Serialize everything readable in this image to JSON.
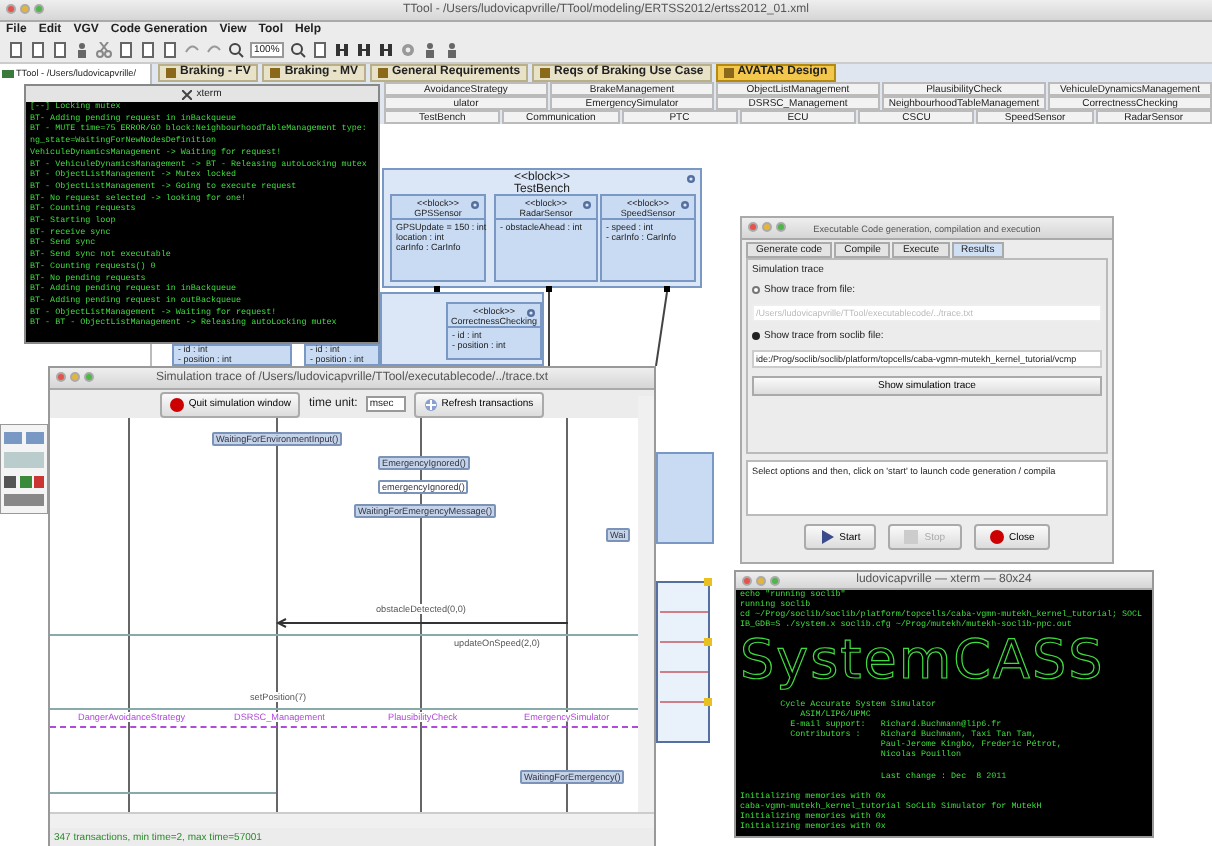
{
  "main_window": {
    "title": "TTool - /Users/ludovicapvrille/TTool/modeling/ERTSS2012/ertss2012_01.xml",
    "menu": [
      "File",
      "Edit",
      "VGV",
      "Code Generation",
      "View",
      "Tool",
      "Help"
    ],
    "zoom": "100%",
    "tree_root": "TTool - /Users/ludovicapvrille/",
    "tabs": [
      {
        "label": "Braking - FV",
        "selected": false
      },
      {
        "label": "Braking - MV",
        "selected": false
      },
      {
        "label": "General Requirements",
        "selected": false
      },
      {
        "label": "Reqs of Braking Use Case",
        "selected": false
      },
      {
        "label": "AVATAR Design",
        "selected": true
      }
    ],
    "diagram_tab_rows": [
      [
        "AvoidanceStrategy",
        "BrakeManagement",
        "ObjectListManagement",
        "PlausibilityCheck",
        "VehiculeDynamicsManagement"
      ],
      [
        "ulator",
        "EmergencySimulator",
        "DSRSC_Management",
        "NeighbourhoodTableManagement",
        "CorrectnessChecking"
      ],
      [
        "TestBench",
        "Communication",
        "PTC",
        "ECU",
        "CSCU",
        "SpeedSensor",
        "RadarSensor"
      ]
    ],
    "blocks": [
      {
        "stereotype": "<<block>>",
        "name": "TestBench",
        "children": [
          {
            "stereotype": "<<block>>",
            "name": "GPSSensor",
            "attributes": [
              "GPSUpdate = 150 : int",
              "location : int",
              "carInfo : CarInfo"
            ]
          },
          {
            "stereotype": "<<block>>",
            "name": "RadarSensor",
            "attributes": [
              "- obstacleAhead : int"
            ]
          },
          {
            "stereotype": "<<block>>",
            "name": "SpeedSensor",
            "attributes": [
              "- speed : int",
              "- carInfo : CarInfo"
            ]
          }
        ]
      },
      {
        "children": [
          {
            "attributes": [
              "- id : int",
              "- position : int"
            ]
          },
          {
            "attributes": [
              "- id : int",
              "- position : int"
            ]
          },
          {
            "stereotype": "<<block>>",
            "name": "CorrectnessChecking",
            "attributes": [
              "- id : int",
              "- position : int"
            ]
          }
        ]
      }
    ]
  },
  "xterm": {
    "title": "xterm",
    "lines": [
      "[--] Locking mutex",
      "BT- Adding pending request in inBackqueue",
      "BT - MUTE time=75 ERROR/GO block:NeighbourhoodTableManagement type:",
      "ng_state=WaitingForNewNodesDefinition",
      "VehiculeDynamicsManagement -> Waiting for request!",
      "BT - VehiculeDynamicsManagement -> BT - Releasing autoLocking mutex",
      "BT - ObjectListManagement -> Mutex locked",
      "BT - ObjectListManagement -> Going to execute request",
      "BT- No request selected -> looking for one!",
      "BT- Counting requests",
      "BT- Starting loop",
      "BT- receive sync",
      "BT- Send sync",
      "BT- Send sync not executable",
      "BT- Counting requests() 0",
      "BT- No pending requests",
      "BT- Adding pending request in inBackqueue",
      "BT- Adding pending request in outBackqueue",
      "BT - ObjectListManagement -> Waiting for request!",
      "BT - BT - ObjectListManagement -> Releasing autoLocking mutex"
    ]
  },
  "simulation_trace": {
    "title": "Simulation trace of /Users/ludovicapvrille/TTool/executablecode/../trace.txt",
    "quit_button": "Quit simulation window",
    "time_unit_label": "time unit:",
    "time_unit": "msec",
    "refresh_button": "Refresh transactions",
    "events": [
      {
        "label": "WaitingForEnvironmentInput()",
        "kind": "state"
      },
      {
        "label": "EmergencyIgnored()",
        "kind": "state"
      },
      {
        "label": "emergencyIgnored()",
        "kind": "action"
      },
      {
        "label": "WaitingForEmergencyMessage()",
        "kind": "state"
      },
      {
        "label": "Wai",
        "kind": "state"
      },
      {
        "label": "obstacleDetected(0,0)",
        "kind": "message"
      },
      {
        "label": "updateOnSpeed(2,0)",
        "kind": "message"
      },
      {
        "label": "setPosition(7)",
        "kind": "message"
      },
      {
        "label": "WaitingForEmergency()",
        "kind": "state"
      }
    ],
    "lifelines": [
      "DangerAvoidanceStrategy",
      "DSRSC_Management",
      "PlausibilityCheck",
      "EmergencySimulator"
    ],
    "status": "347 transactions, min time=2, max time=57001"
  },
  "code_generation": {
    "title": "Executable Code generation, compilation and execution",
    "tabs": [
      {
        "label": "Generate code",
        "selected": false
      },
      {
        "label": "Compile",
        "selected": false
      },
      {
        "label": "Execute",
        "selected": false
      },
      {
        "label": "Results",
        "selected": true
      }
    ],
    "group": "Simulation trace",
    "options": [
      {
        "label": "Show trace from file:",
        "selected": false,
        "path": "/Users/ludovicapvrille/TTool/executablecode/../trace.txt"
      },
      {
        "label": "Show trace from soclib file:",
        "selected": true,
        "path": "ide:/Prog/soclib/soclib/platform/topcells/caba-vgmn-mutekh_kernel_tutorial/vcmp"
      }
    ],
    "show_button": "Show simulation trace",
    "log": "Select options and then, click on 'start' to launch code generation / compila",
    "buttons": [
      {
        "label": "Start",
        "kind": "start",
        "disabled": false
      },
      {
        "label": "Stop",
        "kind": "stop",
        "disabled": true
      },
      {
        "label": "Close",
        "kind": "close",
        "disabled": false
      }
    ]
  },
  "terminal": {
    "title": "ludovicapvrille — xterm — 80x24",
    "lines_top": [
      "echo \"running soclib\"",
      "running soclib",
      "cd ~/Prog/soclib/soclib/platform/topcells/caba-vgmn-mutekh_kernel_tutorial; SOCL",
      "IB_GDB=S ./system.x soclib.cfg ~/Prog/mutekh/mutekh-soclib-ppc.out"
    ],
    "banner": "SystemCASS",
    "line_groups": [
      [
        "        Cycle Accurate System Simulator",
        "            ASIM/LIP6/UPMC",
        "          E-mail support:   Richard.Buchmann@lip6.fr",
        "          Contributors :    Richard Buchmann, Taxi Tan Tam,",
        "                            Paul-Jerome Kingbo, Frederic Pétrot,",
        "                            Nicolas Pouillon"
      ],
      [
        "                            Last change : Dec  8 2011"
      ],
      [
        "Initializing memories with 0x",
        "caba-vgmn-mutekh_kernel_tutorial SoCLib Simulator for MutekH",
        "Initializing memories with 0x",
        "Initializing memories with 0x"
      ]
    ]
  }
}
